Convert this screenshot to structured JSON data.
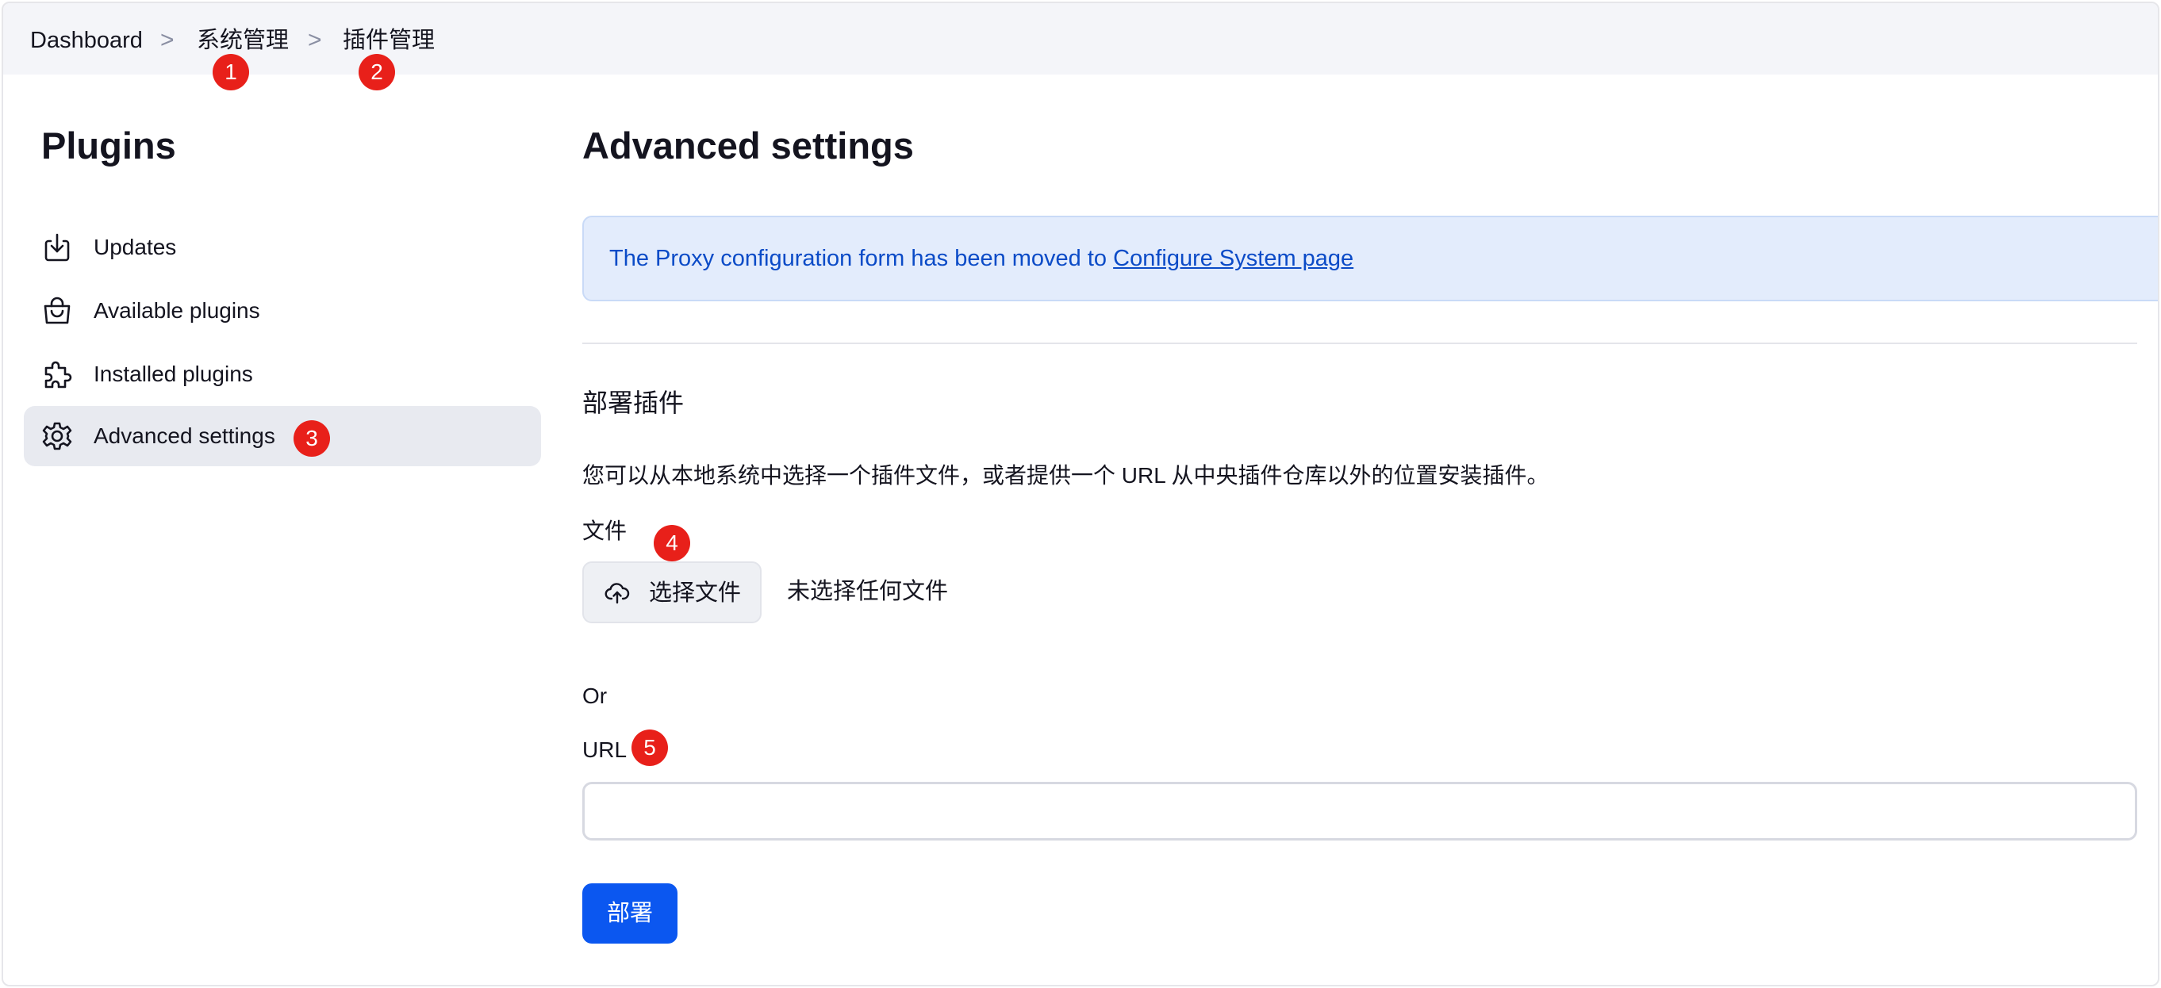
{
  "breadcrumb": {
    "items": [
      "Dashboard",
      "系统管理",
      "插件管理"
    ],
    "separator": ">"
  },
  "markers": [
    "1",
    "2",
    "3",
    "4",
    "5"
  ],
  "sidebar": {
    "title": "Plugins",
    "items": [
      {
        "label": "Updates",
        "icon": "download-icon",
        "active": false
      },
      {
        "label": "Available plugins",
        "icon": "shopping-bag-icon",
        "active": false
      },
      {
        "label": "Installed plugins",
        "icon": "puzzle-icon",
        "active": false
      },
      {
        "label": "Advanced settings",
        "icon": "gear-icon",
        "active": true
      }
    ]
  },
  "main": {
    "title": "Advanced settings",
    "notice": {
      "text": "The Proxy configuration form has been moved to ",
      "link": "Configure System page"
    },
    "deploy_section": {
      "heading": "部署插件",
      "description": "您可以从本地系统中选择一个插件文件，或者提供一个 URL 从中央插件仓库以外的位置安装插件。",
      "file_label": "文件",
      "file_button": "选择文件",
      "file_status": "未选择任何文件",
      "or_label": "Or",
      "url_label": "URL",
      "url_value": "",
      "deploy_button": "部署"
    }
  },
  "colors": {
    "accent": "#0b57f0",
    "notice_bg": "#e3ecfc",
    "notice_text": "#0b4bc7",
    "marker": "#e8201a",
    "active_item_bg": "#e8eaf0"
  }
}
